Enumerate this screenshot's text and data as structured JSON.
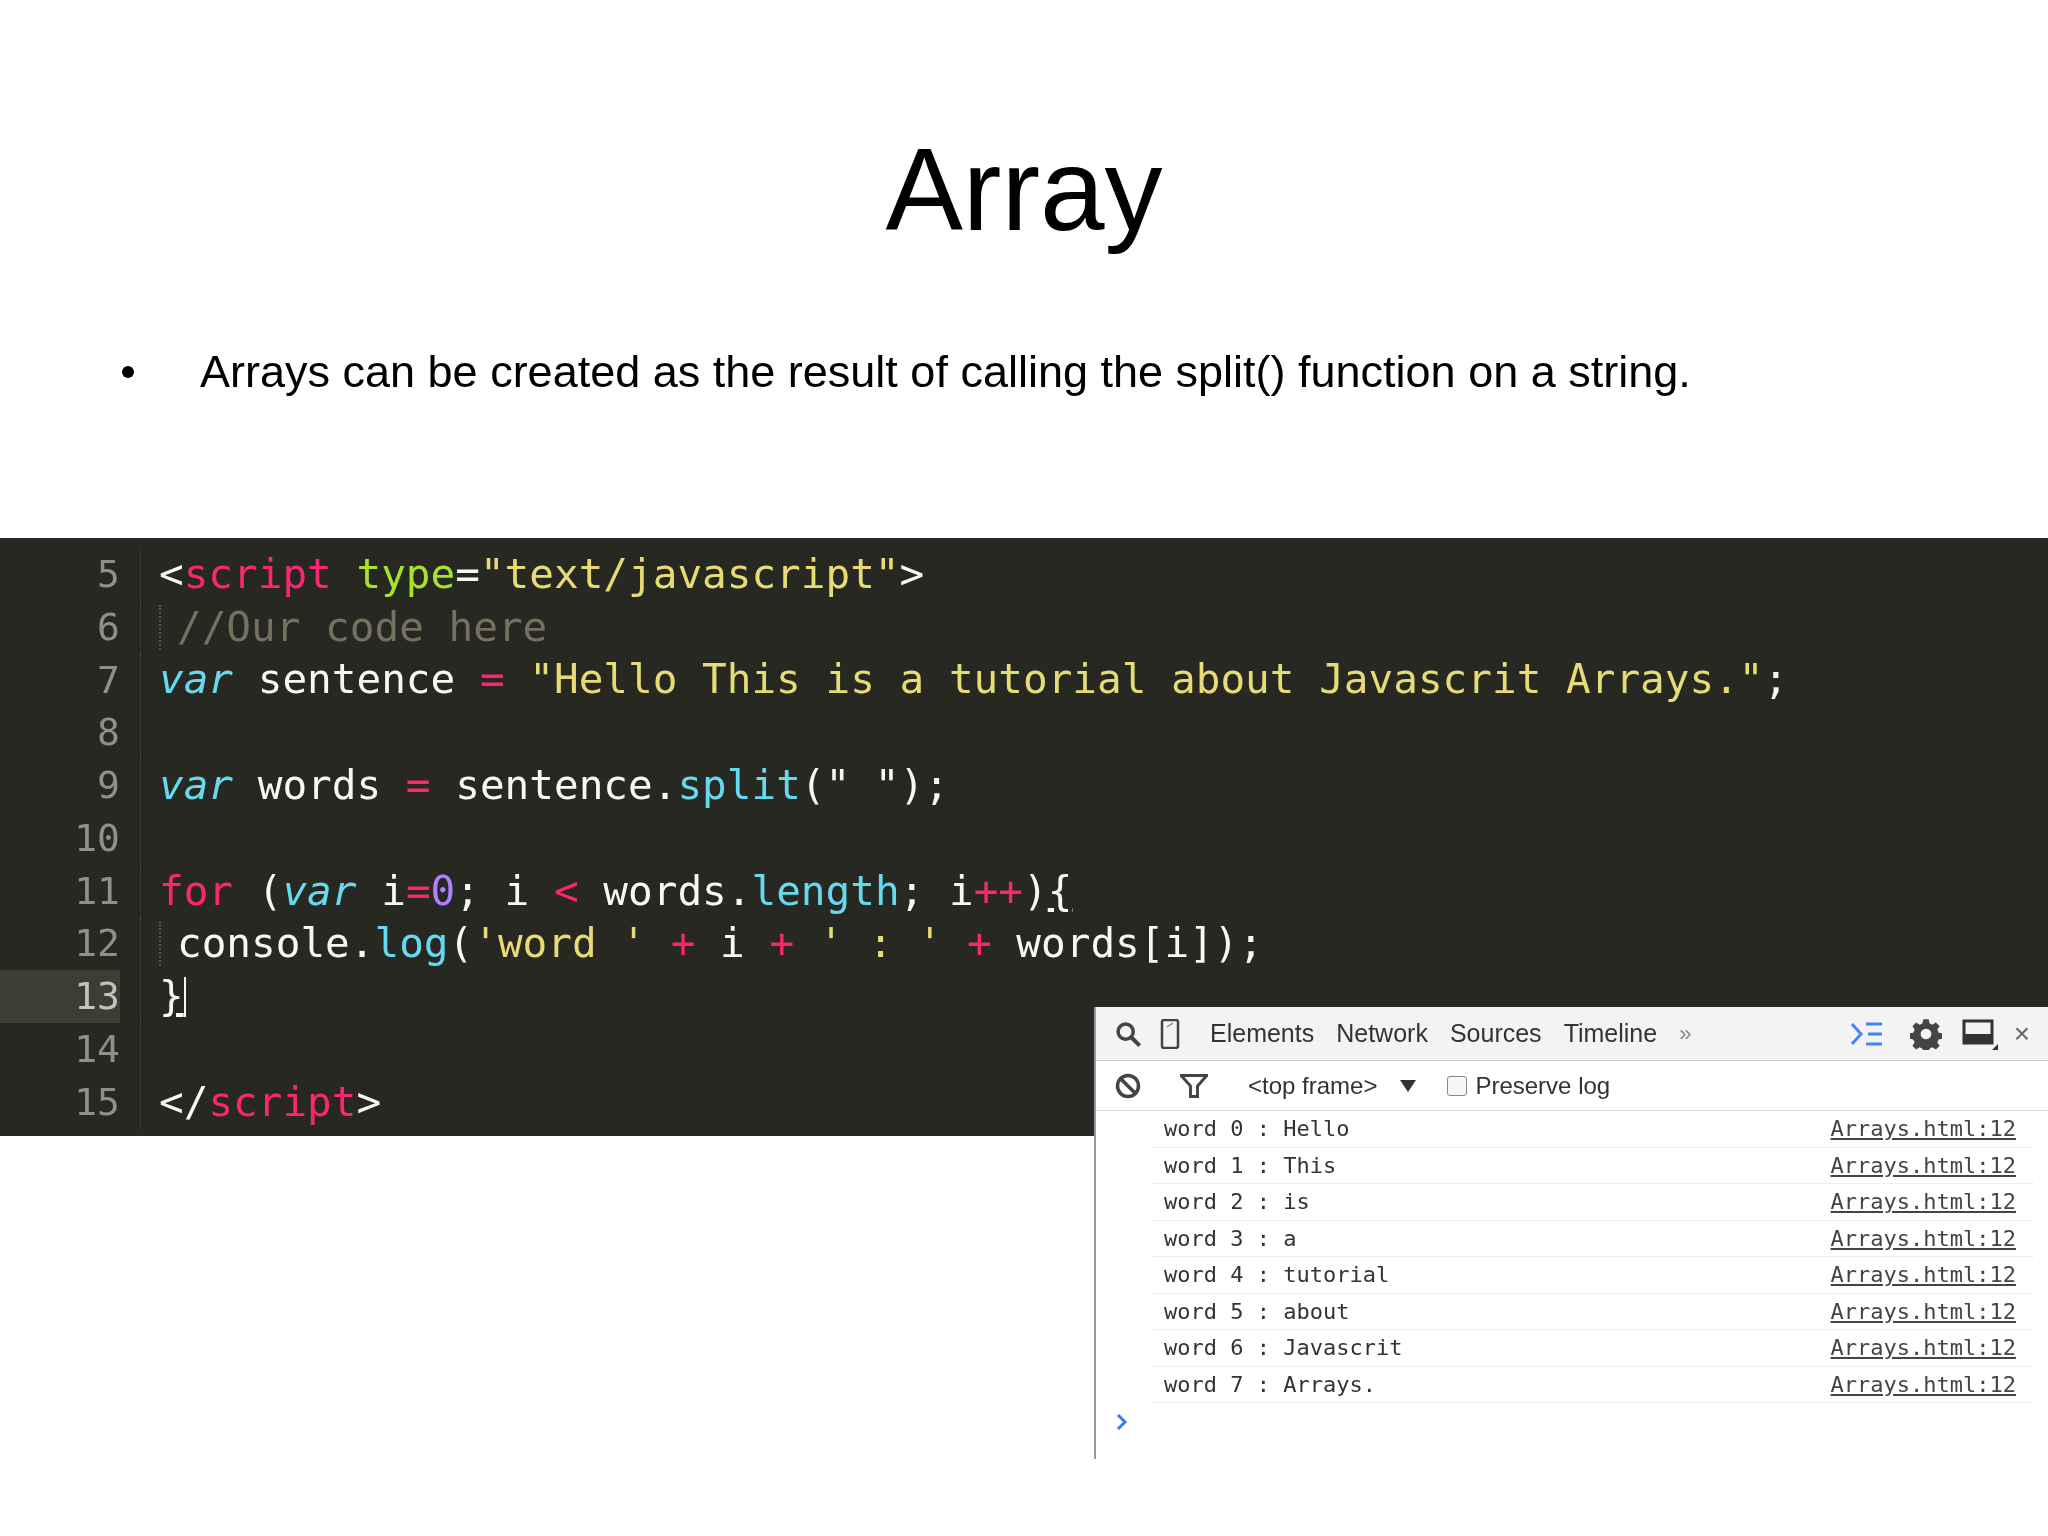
{
  "slide": {
    "title": "Array",
    "bullets": [
      "Arrays can be created as the result of calling the split() function on a string."
    ]
  },
  "editor": {
    "lines": [
      {
        "number": "5",
        "current": false,
        "indent": false,
        "tokens": [
          {
            "text": "<",
            "kind": "plain"
          },
          {
            "text": "script",
            "kind": "tag"
          },
          {
            "text": " type",
            "kind": "attr"
          },
          {
            "text": "=",
            "kind": "plain"
          },
          {
            "text": "\"text/javascript\"",
            "kind": "string"
          },
          {
            "text": ">",
            "kind": "plain"
          }
        ]
      },
      {
        "number": "6",
        "current": false,
        "indent": true,
        "tokens": [
          {
            "text": "//Our code here",
            "kind": "comment"
          }
        ]
      },
      {
        "number": "7",
        "current": false,
        "indent": false,
        "tokens": [
          {
            "text": "var",
            "kind": "keyword"
          },
          {
            "text": " sentence ",
            "kind": "plain"
          },
          {
            "text": "=",
            "kind": "operator"
          },
          {
            "text": " \"Hello This is a tutorial about Javascrit Arrays.\"",
            "kind": "string"
          },
          {
            "text": ";",
            "kind": "plain"
          }
        ]
      },
      {
        "number": "8",
        "current": false
      },
      {
        "number": "9",
        "current": false,
        "indent": false,
        "tokens": [
          {
            "text": "var",
            "kind": "keyword"
          },
          {
            "text": " words ",
            "kind": "plain"
          },
          {
            "text": "=",
            "kind": "operator"
          },
          {
            "text": " sentence.",
            "kind": "plain"
          },
          {
            "text": "split",
            "kind": "function"
          },
          {
            "text": "(\" \");",
            "kind": "plain"
          }
        ]
      },
      {
        "number": "10",
        "current": false
      },
      {
        "number": "11",
        "current": false,
        "indent": false,
        "tokens": [
          {
            "text": "for",
            "kind": "operator"
          },
          {
            "text": " (",
            "kind": "plain"
          },
          {
            "text": "var",
            "kind": "keyword"
          },
          {
            "text": " i",
            "kind": "plain"
          },
          {
            "text": "=",
            "kind": "operator"
          },
          {
            "text": "0",
            "kind": "number"
          },
          {
            "text": "; i ",
            "kind": "plain"
          },
          {
            "text": "<",
            "kind": "operator"
          },
          {
            "text": " words.",
            "kind": "plain"
          },
          {
            "text": "length",
            "kind": "function"
          },
          {
            "text": "; i",
            "kind": "plain"
          },
          {
            "text": "++",
            "kind": "operator"
          },
          {
            "text": ")",
            "kind": "plain"
          },
          {
            "text": "{",
            "kind": "brace"
          }
        ]
      },
      {
        "number": "12",
        "current": false,
        "indent": true,
        "tokens": [
          {
            "text": "console.",
            "kind": "plain"
          },
          {
            "text": "log",
            "kind": "function"
          },
          {
            "text": "(",
            "kind": "plain"
          },
          {
            "text": "'word '",
            "kind": "string"
          },
          {
            "text": " +",
            "kind": "operator"
          },
          {
            "text": " i ",
            "kind": "plain"
          },
          {
            "text": "+",
            "kind": "operator"
          },
          {
            "text": " ' : '",
            "kind": "string"
          },
          {
            "text": " +",
            "kind": "operator"
          },
          {
            "text": " words[i]);",
            "kind": "plain"
          }
        ]
      },
      {
        "number": "13",
        "current": true,
        "indent": false,
        "tokens": [
          {
            "text": "}",
            "kind": "brace"
          }
        ]
      },
      {
        "number": "14",
        "current": false
      },
      {
        "number": "15",
        "current": false,
        "indent": false,
        "tokens": [
          {
            "text": "</",
            "kind": "plain"
          },
          {
            "text": "script",
            "kind": "tag"
          },
          {
            "text": ">",
            "kind": "plain"
          }
        ]
      }
    ]
  },
  "devtools": {
    "tabs": [
      {
        "label": "Elements",
        "selected": false
      },
      {
        "label": "Network",
        "selected": false
      },
      {
        "label": "Sources",
        "selected": false
      },
      {
        "label": "Timeline",
        "selected": false
      }
    ],
    "more": "»",
    "console_selected": true,
    "close": "×",
    "filter": {
      "frame": "<top frame>",
      "preserve_log": {
        "label": "Preserve log",
        "checked": false
      }
    },
    "messages": [
      {
        "text": "word 0 : Hello",
        "source": "Arrays.html:12"
      },
      {
        "text": "word 1 : This",
        "source": "Arrays.html:12"
      },
      {
        "text": "word 2 : is",
        "source": "Arrays.html:12"
      },
      {
        "text": "word 3 : a",
        "source": "Arrays.html:12"
      },
      {
        "text": "word 4 : tutorial",
        "source": "Arrays.html:12"
      },
      {
        "text": "word 5 : about",
        "source": "Arrays.html:12"
      },
      {
        "text": "word 6 : Javascrit",
        "source": "Arrays.html:12"
      },
      {
        "text": "word 7 : Arrays.",
        "source": "Arrays.html:12"
      }
    ]
  }
}
